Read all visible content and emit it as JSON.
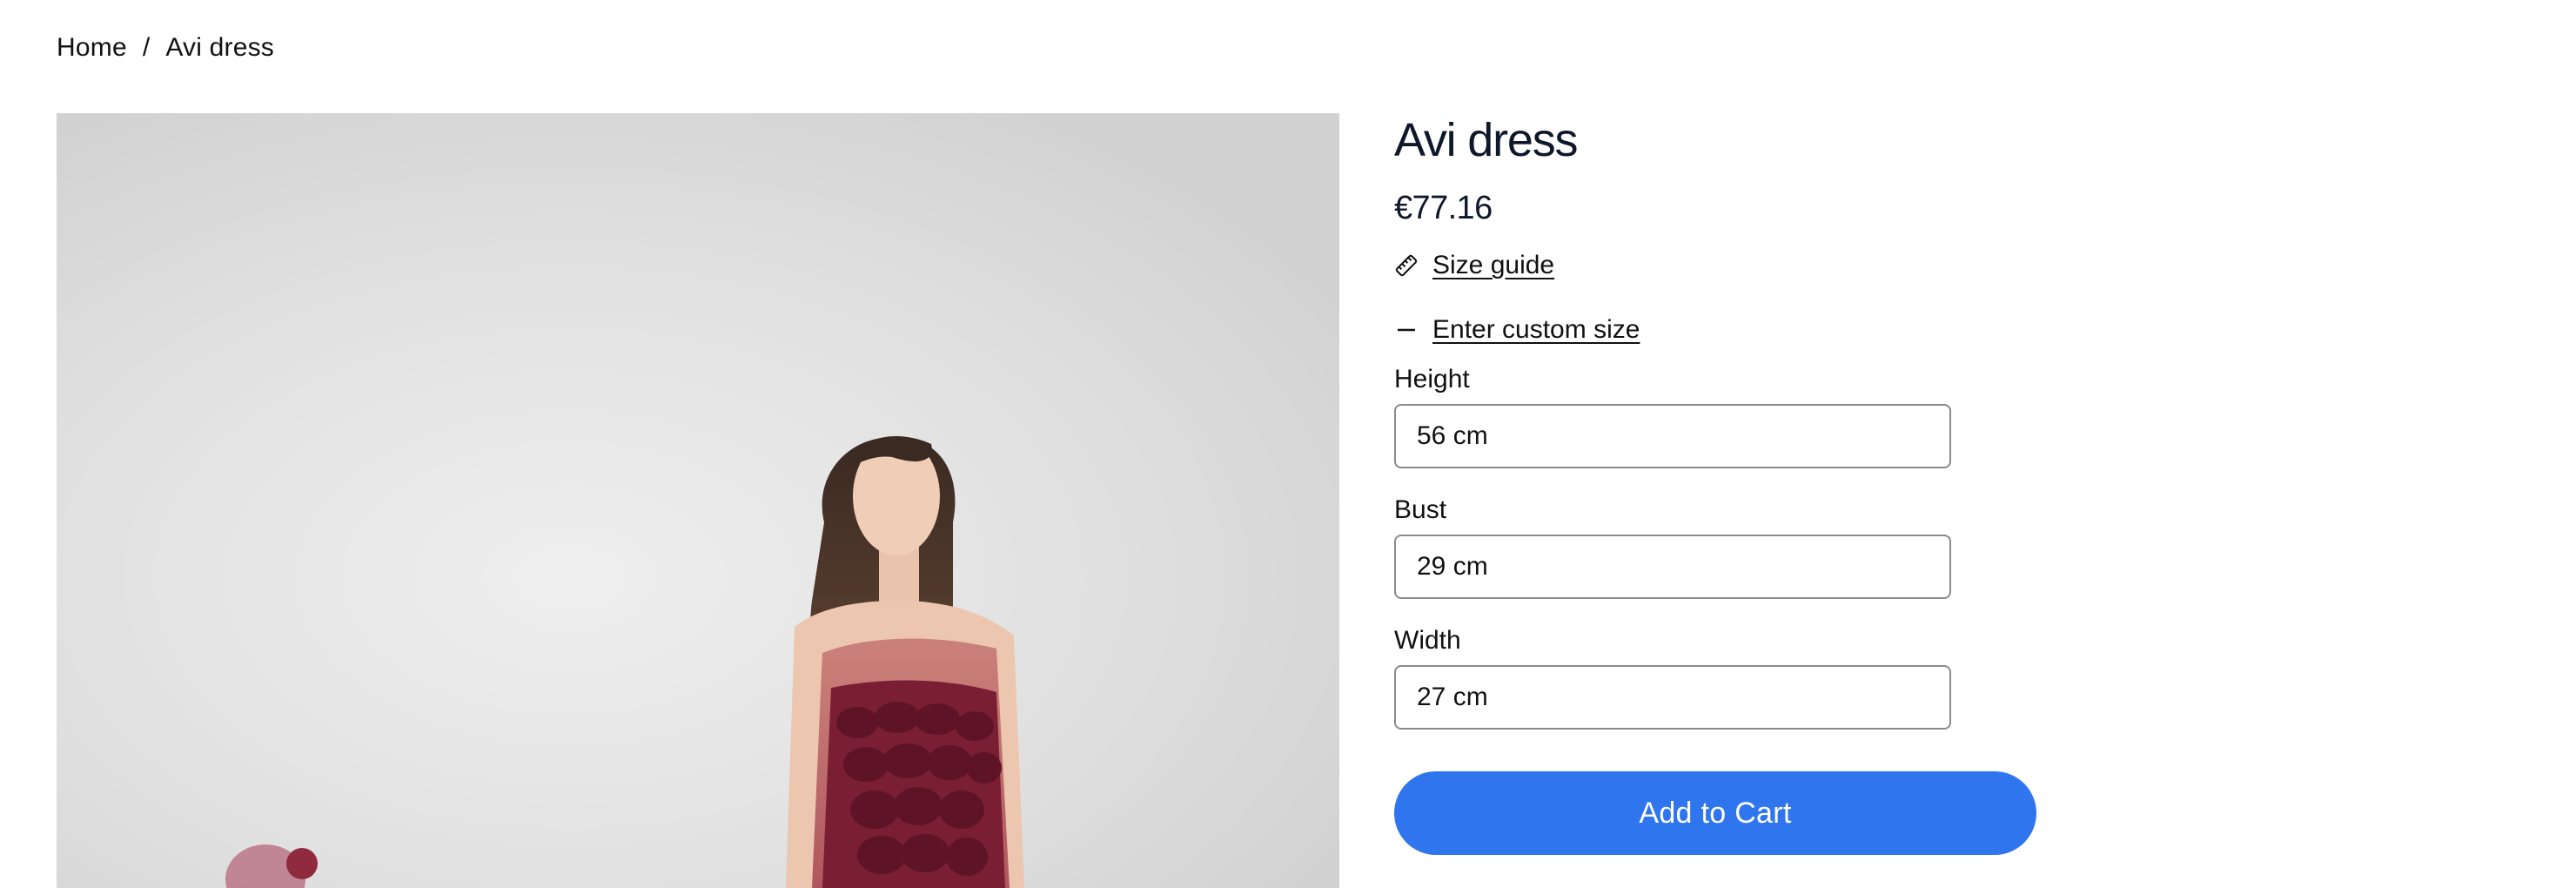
{
  "breadcrumb": {
    "home": "Home",
    "separator": "/",
    "current": "Avi dress"
  },
  "product": {
    "title": "Avi dress",
    "price": "€77.16",
    "size_guide_label": "Size guide",
    "custom_size_label": "Enter custom size"
  },
  "custom_size": {
    "height": {
      "label": "Height",
      "value": "56 cm"
    },
    "bust": {
      "label": "Bust",
      "value": "29 cm"
    },
    "width": {
      "label": "Width",
      "value": "27 cm"
    }
  },
  "cart": {
    "add_label": "Add to Cart"
  },
  "icons": {
    "size_guide": "ruler-icon",
    "custom_size": "minus-icon"
  },
  "colors": {
    "accent": "#2f76ee",
    "dress": "#7a1f33"
  }
}
